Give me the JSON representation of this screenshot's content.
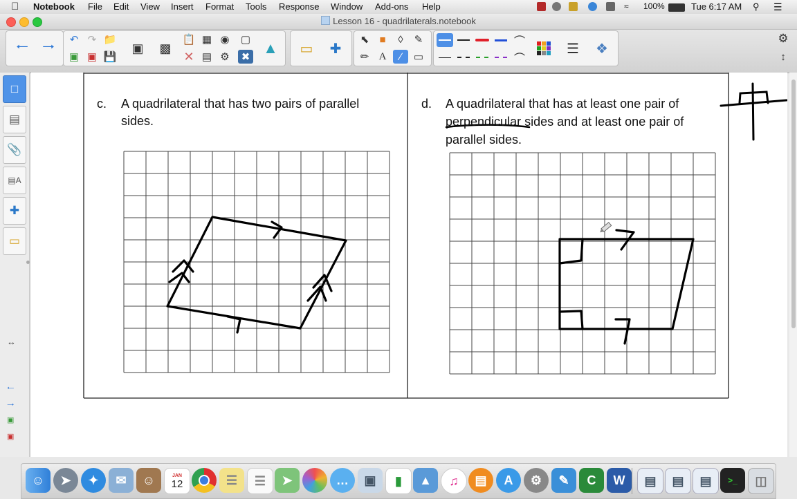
{
  "menubar": {
    "app_name": "Notebook",
    "items": [
      "File",
      "Edit",
      "View",
      "Insert",
      "Format",
      "Tools",
      "Response",
      "Window",
      "Add-ons",
      "Help"
    ],
    "battery": "100%",
    "clock": "Tue 6:17 AM"
  },
  "window": {
    "title": "Lesson 16 - quadrilaterals.notebook"
  },
  "page": {
    "item_c": {
      "letter": "c.",
      "line1": "A quadrilateral that has two pairs of parallel",
      "line2": "sides."
    },
    "item_d": {
      "letter": "d.",
      "line1": "A quadrilateral that has at least one pair of",
      "line2_word": "perpendicular",
      "line2_rest": " sides and at least one pair of",
      "line3": "parallel sides."
    }
  },
  "colors": {
    "selected_tool": "#4d8fe6",
    "active_tab": "#4f93e8",
    "ink": "#000000",
    "red_pen": "#e0202a",
    "blue_pen": "#2250d8",
    "green_pen": "#2aa02a",
    "purple_pen": "#8a2fc8"
  },
  "icons": {
    "toolbar": [
      "back-arrow-icon",
      "forward-arrow-icon",
      "undo-icon",
      "redo-icon",
      "open-icon",
      "add-page-icon",
      "delete-page-icon",
      "save-icon",
      "screen-shade-icon",
      "screen-capture-icon",
      "paste-icon",
      "table-icon",
      "document-camera-icon",
      "delete-icon",
      "display-icon",
      "close-box-icon",
      "fullscreen-icon",
      "lesson-activity-icon",
      "addon-icon",
      "select-icon",
      "shapes-icon",
      "fill-icon",
      "pen-icon",
      "text-icon",
      "line-icon",
      "eraser-icon",
      "color-palette-icon",
      "properties-icon",
      "magic-pen-icon",
      "settings-icon",
      "resize-icon"
    ],
    "side_tabs": [
      "page-sorter-icon",
      "gallery-icon",
      "attachments-icon",
      "properties-icon",
      "addons-icon",
      "lesson-activity-icon"
    ],
    "dock": [
      "finder-icon",
      "launchpad-icon",
      "safari-icon",
      "mail-icon",
      "contacts-icon",
      "calendar-icon",
      "chrome-icon",
      "notes-icon",
      "reminders-icon",
      "maps-icon",
      "photos-icon",
      "messages-icon",
      "preview-icon",
      "numbers-icon",
      "keynote-icon",
      "itunes-icon",
      "ibooks-icon",
      "app-store-icon",
      "system-preferences-icon",
      "notebook-icon",
      "camtasia-icon",
      "word-icon",
      "document-icon",
      "document-icon",
      "document-icon",
      "terminal-icon",
      "trash-icon"
    ]
  },
  "dock": {
    "calendar_month": "JAN",
    "calendar_day": "12"
  }
}
